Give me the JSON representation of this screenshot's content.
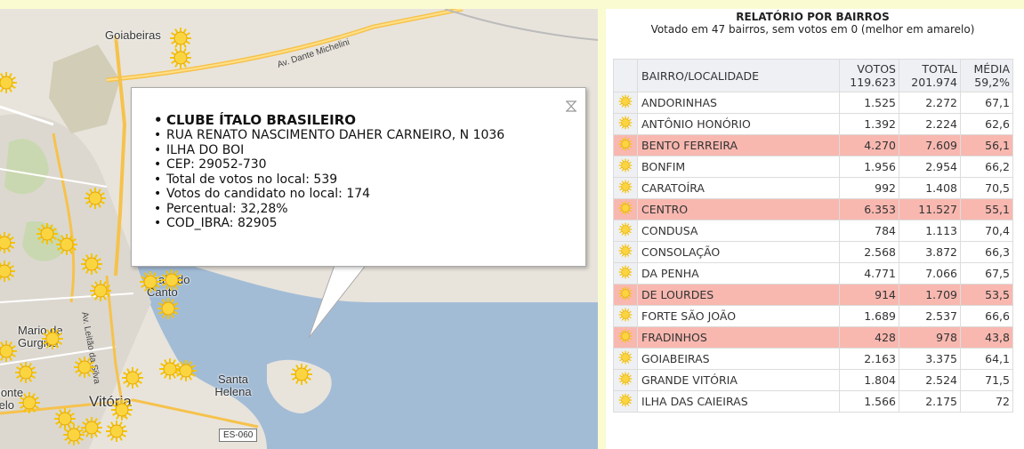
{
  "map": {
    "labels": [
      "Goiabeiras",
      "Av. Dante Michelini",
      "Praia do Canto",
      "Mario de Gurgica",
      "Santa Helena",
      "Monte Belo",
      "Vitória",
      "Av. Leitão da Silva",
      "ES-060"
    ],
    "marker_icon": "sun-marker-icon"
  },
  "popup": {
    "title": "CLUBE ÍTALO BRASILEIRO",
    "lines": [
      "RUA RENATO NASCIMENTO DAHER CARNEIRO, N 1036",
      "ILHA DO BOI",
      "CEP: 29052-730",
      "Total de votos no local: 539",
      "Votos do candidato no local: 174",
      "Percentual: 32,28%",
      "COD_IBRA: 82905"
    ],
    "close_icon": "close-icon"
  },
  "report": {
    "title": "RELATÓRIO POR BAIRROS",
    "subtitle": "Votado em 47 bairros, sem votos em 0 (melhor em amarelo)",
    "headers": {
      "name": "BAIRRO/LOCALIDADE",
      "votos": "VOTOS",
      "votos_total": "119.623",
      "total": "TOTAL",
      "total_total": "201.974",
      "media": "MÉDIA",
      "media_total": "59,2%"
    },
    "highlight_color": "#f8b8b0",
    "rows": [
      {
        "name": "ANDORINHAS",
        "votos": "1.525",
        "total": "2.272",
        "media": "67,1",
        "hl": false
      },
      {
        "name": "ANTÔNIO HONÓRIO",
        "votos": "1.392",
        "total": "2.224",
        "media": "62,6",
        "hl": false
      },
      {
        "name": "BENTO FERREIRA",
        "votos": "4.270",
        "total": "7.609",
        "media": "56,1",
        "hl": true
      },
      {
        "name": "BONFIM",
        "votos": "1.956",
        "total": "2.954",
        "media": "66,2",
        "hl": false
      },
      {
        "name": "CARATOÍRA",
        "votos": "992",
        "total": "1.408",
        "media": "70,5",
        "hl": false
      },
      {
        "name": "CENTRO",
        "votos": "6.353",
        "total": "11.527",
        "media": "55,1",
        "hl": true
      },
      {
        "name": "CONDUSA",
        "votos": "784",
        "total": "1.113",
        "media": "70,4",
        "hl": false
      },
      {
        "name": "CONSOLAÇÃO",
        "votos": "2.568",
        "total": "3.872",
        "media": "66,3",
        "hl": false
      },
      {
        "name": "DA PENHA",
        "votos": "4.771",
        "total": "7.066",
        "media": "67,5",
        "hl": false
      },
      {
        "name": "DE LOURDES",
        "votos": "914",
        "total": "1.709",
        "media": "53,5",
        "hl": true
      },
      {
        "name": "FORTE SÃO JOÃO",
        "votos": "1.689",
        "total": "2.537",
        "media": "66,6",
        "hl": false
      },
      {
        "name": "FRADINHOS",
        "votos": "428",
        "total": "978",
        "media": "43,8",
        "hl": true
      },
      {
        "name": "GOIABEIRAS",
        "votos": "2.163",
        "total": "3.375",
        "media": "64,1",
        "hl": false
      },
      {
        "name": "GRANDE VITÓRIA",
        "votos": "1.804",
        "total": "2.524",
        "media": "71,5",
        "hl": false
      },
      {
        "name": "ILHA DAS CAIEIRAS",
        "votos": "1.566",
        "total": "2.175",
        "media": "72",
        "hl": false
      }
    ]
  }
}
